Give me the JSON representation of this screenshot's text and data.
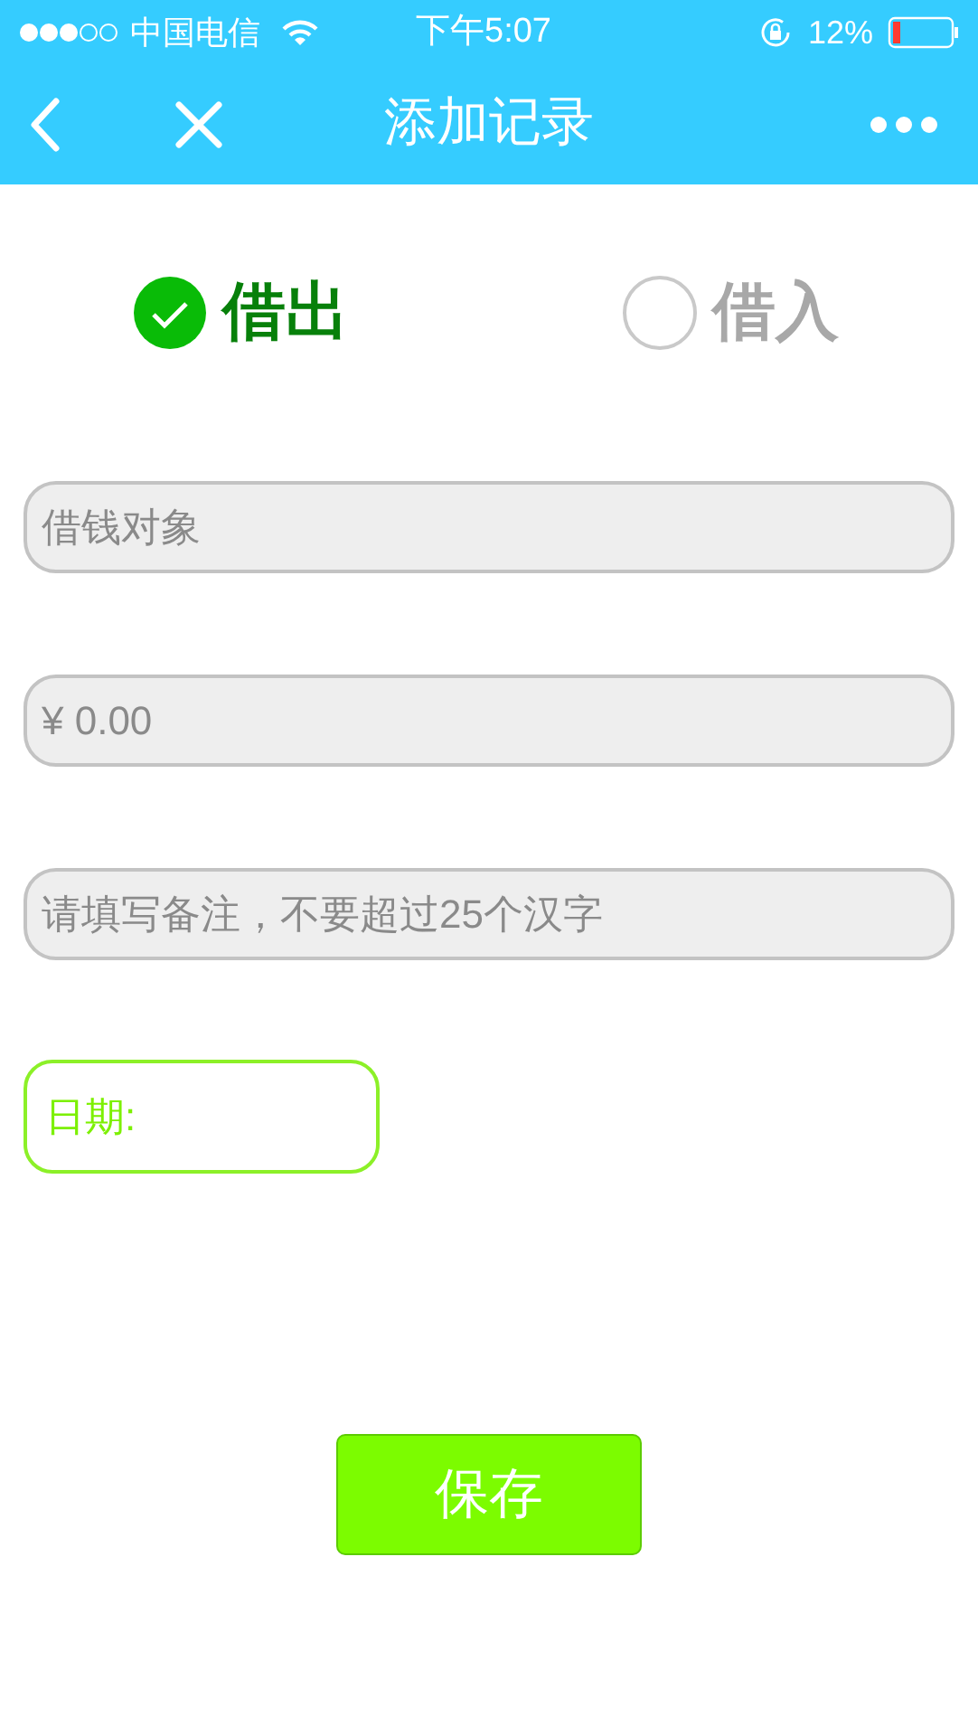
{
  "status_bar": {
    "carrier": "中国电信",
    "time": "下午5:07",
    "battery": "12%"
  },
  "nav": {
    "title": "添加记录"
  },
  "options": [
    {
      "label": "借出",
      "selected": true
    },
    {
      "label": "借入",
      "selected": false
    }
  ],
  "fields": [
    {
      "placeholder": "借钱对象"
    },
    {
      "placeholder": "¥ 0.00"
    },
    {
      "placeholder": "请填写备注，不要超过25个汉字"
    }
  ],
  "date": {
    "label": "日期:"
  },
  "save_button": "保存"
}
